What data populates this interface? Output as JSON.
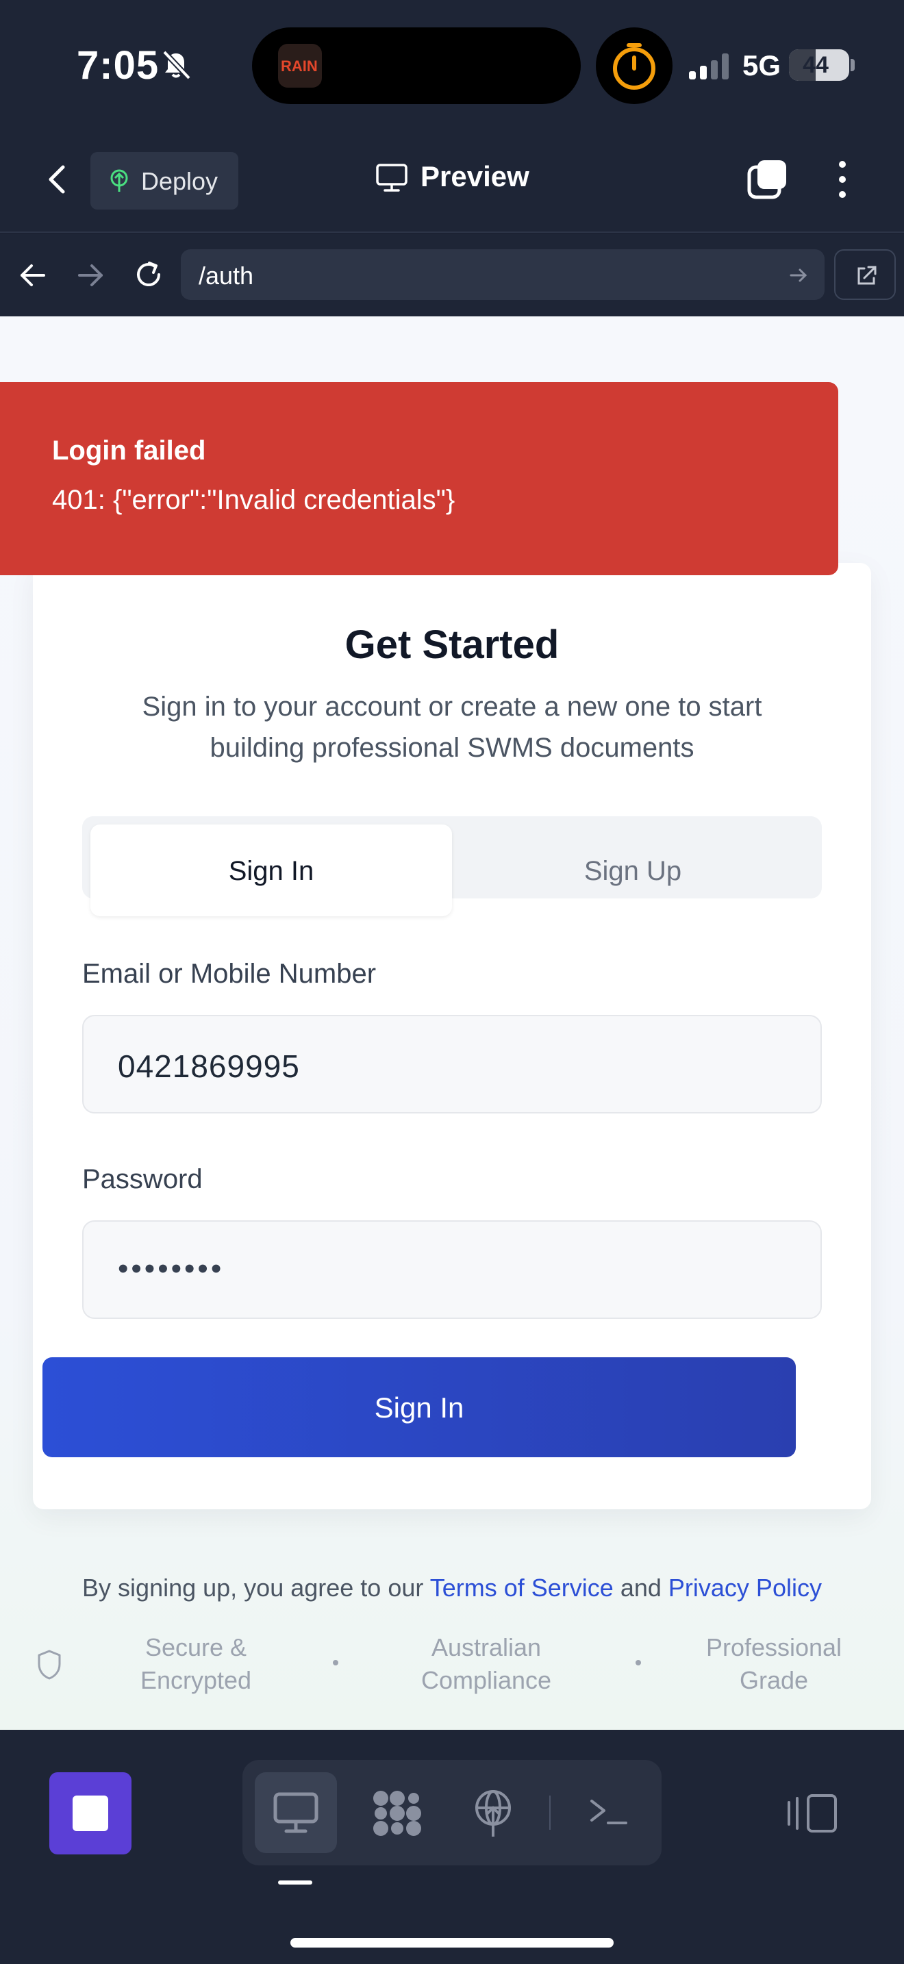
{
  "status_bar": {
    "time": "7:05",
    "network": "5G",
    "battery": "44",
    "battery_level": 0.44,
    "island_app_text": "RAIN"
  },
  "header": {
    "deploy_label": "Deploy",
    "title": "Preview"
  },
  "browser": {
    "url": "/auth"
  },
  "toast": {
    "title": "Login failed",
    "message": "401: {\"error\":\"Invalid credentials\"}"
  },
  "auth_card": {
    "title": "Get Started",
    "subtitle": "Sign in to your account or create a new one to start building professional SWMS documents",
    "tabs": [
      {
        "label": "Sign In",
        "active": true
      },
      {
        "label": "Sign Up",
        "active": false
      }
    ],
    "email_label": "Email or Mobile Number",
    "email_value": "0421869995",
    "password_label": "Password",
    "password_value": "••••••••",
    "submit_label": "Sign In"
  },
  "footer": {
    "terms_prefix": "By signing up, you agree to our",
    "terms_link": "Terms of Service",
    "terms_and": "and",
    "privacy_link": "Privacy Policy",
    "badges": [
      {
        "line1": "Secure &",
        "line2": "Encrypted"
      },
      {
        "line1": "Australian",
        "line2": "Compliance"
      },
      {
        "line1": "Professional",
        "line2": "Grade"
      }
    ]
  },
  "colors": {
    "accent": "#2c4fd6",
    "toast_bg": "#cf3b33",
    "stop_button": "#5b3fd6",
    "chrome_bg": "#1e2536"
  },
  "icons": [
    "bell-slash-icon",
    "timer-icon",
    "signal-icon",
    "chevron-left-icon",
    "deploy-icon",
    "monitor-icon",
    "tabs-icon",
    "more-vertical-icon",
    "arrow-left-icon",
    "arrow-right-icon",
    "reload-icon",
    "external-link-icon",
    "shield-icon",
    "stop-icon",
    "grid-icon",
    "globe-icon",
    "terminal-icon",
    "panel-icon"
  ]
}
